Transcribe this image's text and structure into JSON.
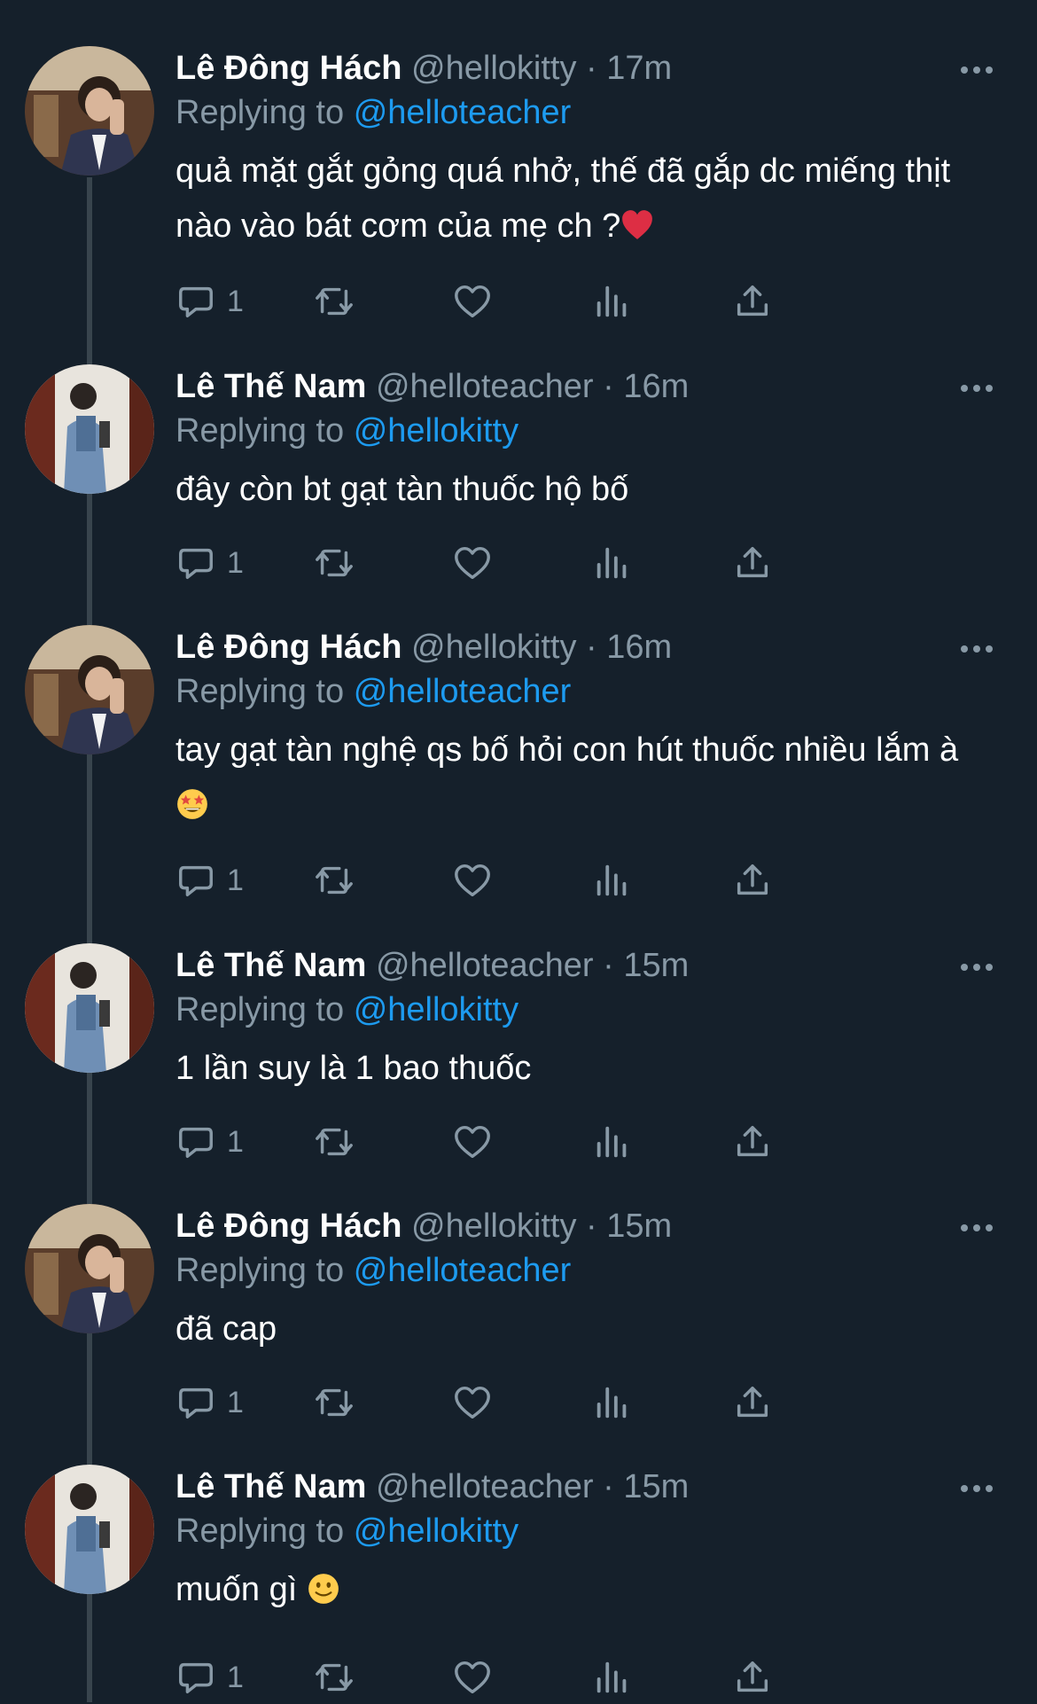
{
  "theme": {
    "background": "#15202b",
    "text": "#ffffff",
    "muted": "#8899a6",
    "accent": "#1d9bf0",
    "thread_line": "#38444d"
  },
  "labels": {
    "replying_to": "Replying to",
    "dot": "·"
  },
  "tweets": [
    {
      "display_name": "Lê Đông Hách",
      "handle": "@hellokitty",
      "time": "17m",
      "replying_to": "@helloteacher",
      "text": "quả mặt gắt gỏng quá nhở, thế đã gắp dc miếng thịt nào vào bát cơm của mẹ ch ?",
      "emoji": "red-heart-emoji",
      "reply_count": "1",
      "avatar": "avatar-photo-donghach"
    },
    {
      "display_name": "Lê Thế Nam",
      "handle": "@helloteacher",
      "time": "16m",
      "replying_to": "@hellokitty",
      "text": "đây còn bt gạt tàn thuốc hộ bố",
      "emoji": "",
      "reply_count": "1",
      "avatar": "avatar-photo-thenam"
    },
    {
      "display_name": "Lê Đông Hách",
      "handle": "@hellokitty",
      "time": "16m",
      "replying_to": "@helloteacher",
      "text": "tay gạt tàn nghệ qs bố hỏi con hút thuốc nhiều lắm à ",
      "emoji": "star-struck-emoji",
      "reply_count": "1",
      "avatar": "avatar-photo-donghach"
    },
    {
      "display_name": "Lê Thế Nam",
      "handle": "@helloteacher",
      "time": "15m",
      "replying_to": "@hellokitty",
      "text": "1 lần suy là 1 bao thuốc",
      "emoji": "",
      "reply_count": "1",
      "avatar": "avatar-photo-thenam"
    },
    {
      "display_name": "Lê Đông Hách",
      "handle": "@hellokitty",
      "time": "15m",
      "replying_to": "@helloteacher",
      "text": "đã cap",
      "emoji": "",
      "reply_count": "1",
      "avatar": "avatar-photo-donghach"
    },
    {
      "display_name": "Lê Thế Nam",
      "handle": "@helloteacher",
      "time": "15m",
      "replying_to": "@hellokitty",
      "text": "muốn gì ",
      "emoji": "slightly-smiling-emoji",
      "reply_count": "1",
      "avatar": "avatar-photo-thenam"
    }
  ]
}
